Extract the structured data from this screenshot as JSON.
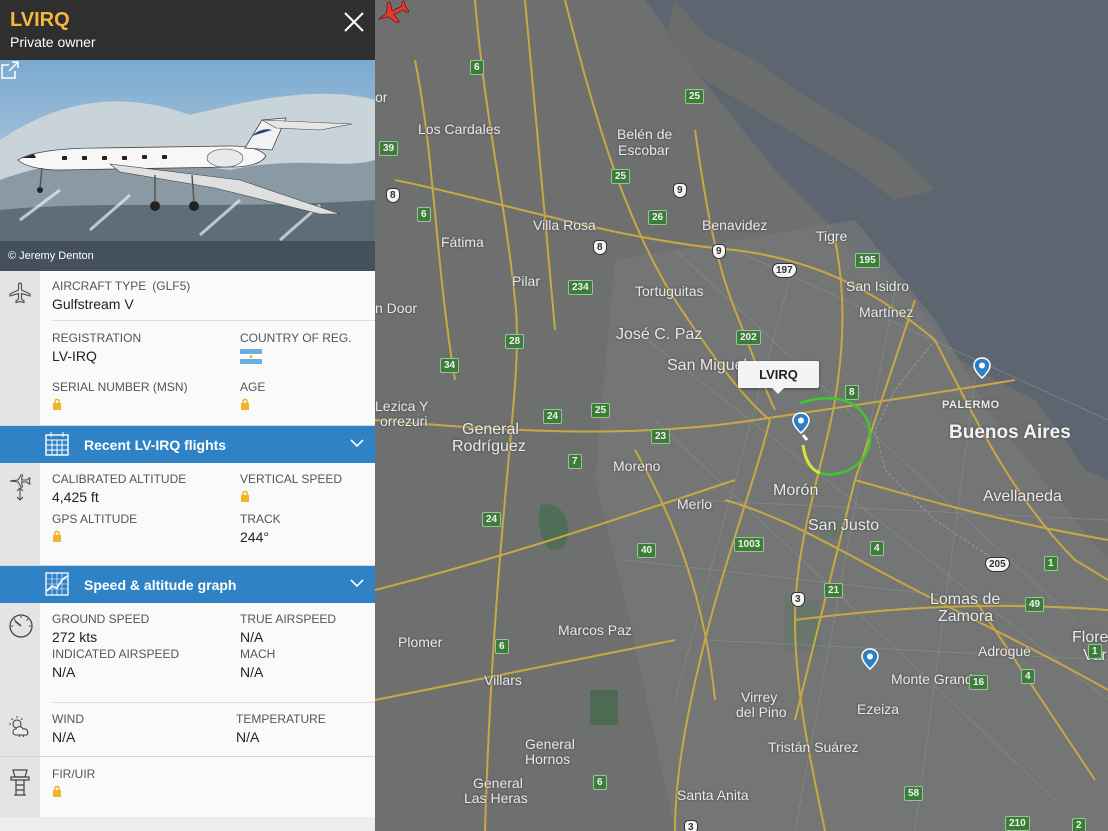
{
  "header": {
    "title": "LVIRQ",
    "subtitle": "Private owner"
  },
  "photo": {
    "credit": "© Jeremy Denton"
  },
  "aircraft": {
    "type_label": "AIRCRAFT TYPE",
    "type_code": "(GLF5)",
    "type_value": "Gulfstream V",
    "registration_label": "REGISTRATION",
    "registration_value": "LV-IRQ",
    "country_label": "COUNTRY OF REG.",
    "serial_label": "SERIAL NUMBER (MSN)",
    "age_label": "AGE"
  },
  "recent_flights": {
    "label": "Recent LV-IRQ flights"
  },
  "altitude": {
    "calibrated_label": "CALIBRATED ALTITUDE",
    "calibrated_value": "4,425 ft",
    "vspeed_label": "VERTICAL SPEED",
    "gps_label": "GPS ALTITUDE",
    "track_label": "TRACK",
    "track_value": "244°"
  },
  "graph_bar": {
    "label": "Speed & altitude graph"
  },
  "speed": {
    "ground_label": "GROUND SPEED",
    "ground_value": "272 kts",
    "true_label": "TRUE AIRSPEED",
    "true_value": "N/A",
    "indicated_label": "INDICATED AIRSPEED",
    "indicated_value": "N/A",
    "mach_label": "MACH",
    "mach_value": "N/A",
    "wind_label": "WIND",
    "wind_value": "N/A",
    "temp_label": "TEMPERATURE",
    "temp_value": "N/A"
  },
  "fir": {
    "label": "FIR/UIR"
  },
  "map": {
    "callsign": "LVIRQ",
    "places": [
      "Los Cardales",
      "Belén de",
      "Escobar",
      "Villa Rosa",
      "Benavidez",
      "Fátima",
      "Tigre",
      "Pilar",
      "Tortuguitas",
      "San Isidro",
      "Martínez",
      "n Door",
      "José C. Paz",
      "San Miguel",
      "Lezica Y",
      "orrezuri",
      "General",
      "Rodríguez",
      "Moreno",
      "PALERMO",
      "Buenos Aires",
      "Merlo",
      "Morón",
      "Avellaneda",
      "San Justo",
      "Lomas de",
      "Zamora",
      "Marcos Paz",
      "Plomer",
      "Adrogué",
      "Flore",
      "Var",
      "Villars",
      "Monte Grande",
      "Virrey",
      "del Pino",
      "Ezeiza",
      "General",
      "Hornos",
      "Tristán Suárez",
      "General",
      "Las Heras",
      "Santa Anita",
      "or"
    ],
    "routes": [
      "6",
      "25",
      "39",
      "8",
      "6",
      "25",
      "9",
      "26",
      "8",
      "9",
      "197",
      "195",
      "234",
      "202",
      "28",
      "34",
      "8",
      "24",
      "25",
      "23",
      "7",
      "24",
      "40",
      "1003",
      "4",
      "3",
      "21",
      "205",
      "1",
      "49",
      "6",
      "1",
      "4",
      "16",
      "6",
      "58",
      "3",
      "210",
      "2"
    ]
  }
}
